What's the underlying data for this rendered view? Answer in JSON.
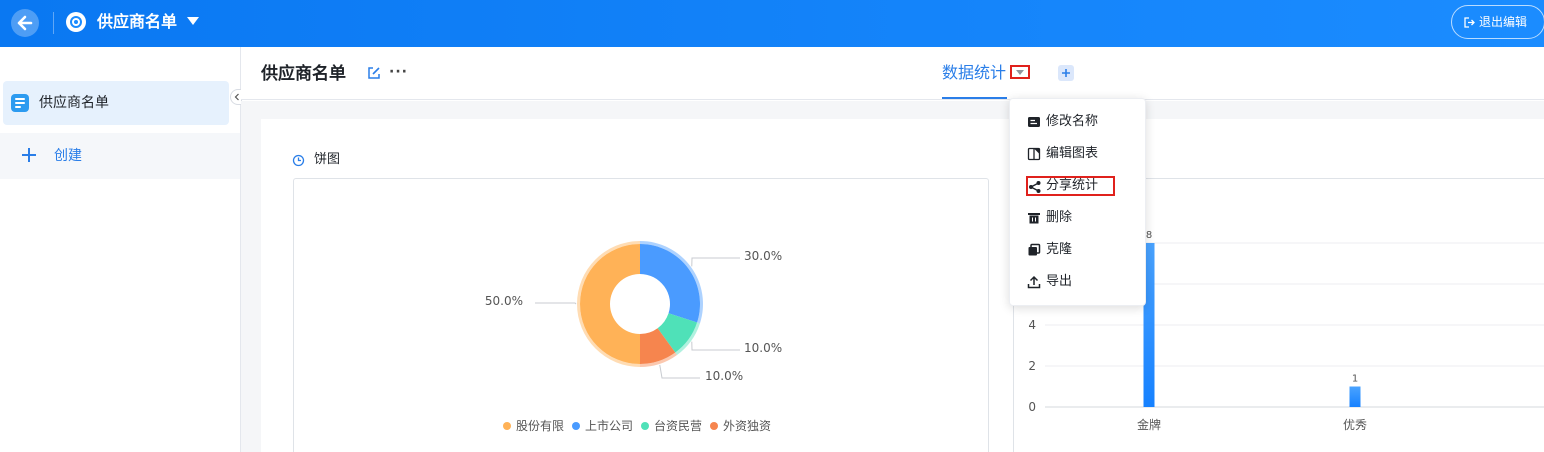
{
  "topbar": {
    "title": "供应商名单",
    "exit_label": "退出编辑"
  },
  "sidebar": {
    "item_label": "供应商名单",
    "create_label": "创建"
  },
  "header": {
    "page_title": "供应商名单",
    "tab_label": "数据统计"
  },
  "menu": {
    "items": [
      "修改名称",
      "编辑图表",
      "分享统计",
      "删除",
      "克隆",
      "导出"
    ]
  },
  "pie_caption": "饼图",
  "colors": {
    "brand": "#1b8cff",
    "accent": "#2a7ee8",
    "highlight": "#e0211c"
  },
  "chart_data": [
    {
      "type": "pie",
      "categories": [
        "股份有限",
        "上市公司",
        "台资民营",
        "外资独资"
      ],
      "values": [
        50.0,
        30.0,
        10.0,
        10.0
      ],
      "value_labels": [
        "50.0%",
        "30.0%",
        "10.0%",
        "10.0%"
      ],
      "colors": [
        "#ffb257",
        "#4a9bff",
        "#4fe1b8",
        "#f6854e"
      ],
      "donut": true,
      "legend": "bottom"
    },
    {
      "type": "bar",
      "categories": [
        "金牌",
        "优秀"
      ],
      "values": [
        8,
        1
      ],
      "data_labels": [
        "8",
        "1"
      ],
      "yticks": [
        "0",
        "2",
        "4"
      ],
      "ylim": [
        0,
        8
      ],
      "grid": true
    }
  ]
}
